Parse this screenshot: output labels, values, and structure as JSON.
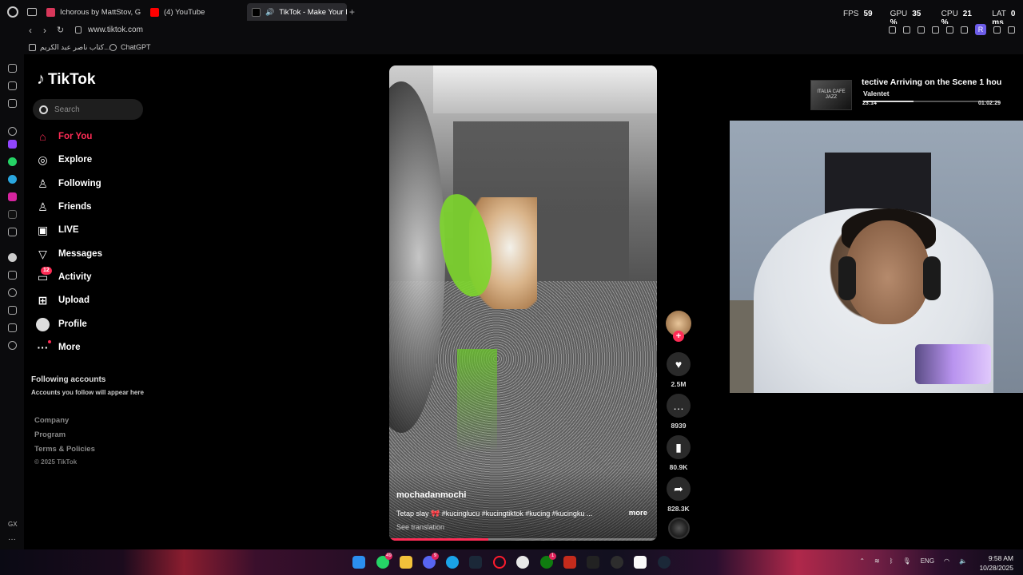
{
  "browser": {
    "tabs": [
      {
        "label": "Ichorous by MattStov, Go",
        "color": "#d8375a"
      },
      {
        "label": "(4) YouTube",
        "color": "#ff0000"
      },
      {
        "label": "TikTok - Make Your D",
        "color": "#111111",
        "active": true
      }
    ],
    "new_tab_symbol": "+",
    "url": "www.tiktok.com",
    "bookmarks": [
      "كتاب ناصر عبد الكريم...",
      "ChatGPT"
    ],
    "perf": {
      "fps_label": "FPS",
      "fps": "59",
      "gpu_label": "GPU",
      "gpu": "35 %",
      "cpu_label": "CPU",
      "cpu": "21 %",
      "lat_label": "LAT",
      "lat": "0 ms"
    },
    "profile_initial": "R",
    "gx_label": "GX"
  },
  "tiktok": {
    "logo": "TikTok",
    "search_placeholder": "Search",
    "nav": [
      {
        "label": "For You",
        "icon": "home-icon",
        "active": true
      },
      {
        "label": "Explore",
        "icon": "compass-icon"
      },
      {
        "label": "Following",
        "icon": "following-icon"
      },
      {
        "label": "Friends",
        "icon": "friends-icon"
      },
      {
        "label": "LIVE",
        "icon": "live-icon"
      },
      {
        "label": "Messages",
        "icon": "messages-icon"
      },
      {
        "label": "Activity",
        "icon": "activity-icon",
        "badge": "12"
      },
      {
        "label": "Upload",
        "icon": "upload-icon"
      },
      {
        "label": "Profile",
        "icon": "profile-icon"
      },
      {
        "label": "More",
        "icon": "more-icon",
        "dot": true
      }
    ],
    "following_title": "Following accounts",
    "following_sub": "Accounts you follow will appear here",
    "footer": [
      "Company",
      "Program",
      "Terms & Policies"
    ],
    "copyright": "© 2025 TikTok",
    "video": {
      "author": "mochadanmochi",
      "caption": "Tetap slay 🎀 #kucinglucu #kucingtiktok #kucing #kucingku ...",
      "more": "more",
      "translate": "See translation",
      "progress": 0.37
    },
    "actions": {
      "likes": "2.5M",
      "comments": "8939",
      "saves": "80.9K",
      "shares": "828.3K"
    },
    "accent": "#fe2c55"
  },
  "mini_player": {
    "title": "tective Arriving on the Scene 1 hou",
    "artist": "Valentet",
    "elapsed": "23:14",
    "duration": "01:02:29",
    "thumb_text": "ITALIA CAFE JAZZ",
    "progress": 0.37
  },
  "taskbar": {
    "badges": {
      "whatsapp": "49",
      "discord": "9",
      "xbox": "1"
    },
    "tray_lang": "ENG",
    "time": "9:58 AM",
    "date": "10/28/2025"
  }
}
